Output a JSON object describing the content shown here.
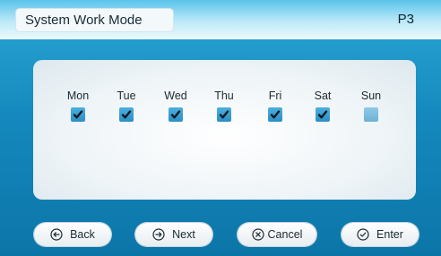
{
  "header": {
    "title": "System Work Mode",
    "page": "P3"
  },
  "days": [
    {
      "label": "Mon",
      "checked": true
    },
    {
      "label": "Tue",
      "checked": true
    },
    {
      "label": "Wed",
      "checked": true
    },
    {
      "label": "Thu",
      "checked": true
    },
    {
      "label": "Fri",
      "checked": true
    },
    {
      "label": "Sat",
      "checked": true
    },
    {
      "label": "Sun",
      "checked": false
    }
  ],
  "buttons": {
    "back": {
      "label": "Back",
      "icon": "arrow-left-circle-icon"
    },
    "next": {
      "label": "Next",
      "icon": "arrow-right-circle-icon"
    },
    "cancel": {
      "label": "Cancel",
      "icon": "x-circle-icon"
    },
    "enter": {
      "label": "Enter",
      "icon": "check-circle-icon"
    }
  },
  "colors": {
    "background": "#1589bd",
    "checkbox": "#2b8fc4",
    "checkbox_unchecked": "#6cb2d6"
  }
}
